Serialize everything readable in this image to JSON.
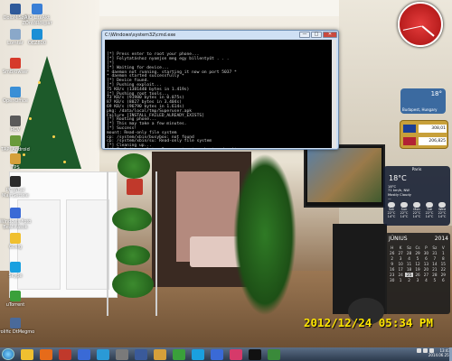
{
  "desktop_icons": [
    {
      "label": "DoloMiSzÓ",
      "icon": "app-icon",
      "color": "#2f5a9a"
    },
    {
      "label": "AIO LiteAkt ZÖntöRökpár",
      "icon": "app-icon",
      "color": "#3a7fd6"
    },
    {
      "label": "Lomtár",
      "icon": "recycle-bin-icon",
      "color": "#8aa8c9"
    },
    {
      "label": "OEZ800",
      "icon": "app-icon",
      "color": "#1c8fd6"
    },
    {
      "label": "SmBrowser",
      "icon": "app-icon",
      "color": "#d63a2a"
    },
    {
      "label": "OpenOffice",
      "icon": "app-icon",
      "color": "#3a8fd6"
    },
    {
      "label": "RCV",
      "icon": "app-icon",
      "color": "#5a5a5a"
    },
    {
      "label": "TAPI Android",
      "icon": "app-icon",
      "color": "#6a9a3a"
    },
    {
      "label": "TPS",
      "icon": "app-icon",
      "color": "#d6a03a"
    },
    {
      "label": "PCIWhal MainSettele",
      "icon": "app-icon",
      "color": "#2a2a2a"
    },
    {
      "label": "Windows Fotó Beállítások",
      "icon": "app-icon",
      "color": "#3a6ad6"
    },
    {
      "label": "Gosig",
      "icon": "app-icon",
      "color": "#f0c030"
    },
    {
      "label": "Skype",
      "icon": "skype-icon",
      "color": "#1aa0e0"
    },
    {
      "label": "uTorrent",
      "icon": "utorrent-icon",
      "color": "#3aa03a"
    },
    {
      "label": "Prolific DtMegmo",
      "icon": "app-icon",
      "color": "#4a6a9a"
    }
  ],
  "cmd_window": {
    "title": "C:\\Windows\\system32\\cmd.exe",
    "minimize": "—",
    "maximize": "□",
    "close": "✕",
    "lines": [
      "[*] Press enter to root your phone...",
      "[*] Folytatáshoz nyomjon meg egy billentyűt . . .",
      "[*]",
      "[*] Waiting for device...",
      "* daemon not running. starting it now on port 5037 *",
      "* daemon started successfully *",
      "[*] Device found.",
      "[*] Pushing exploit...",
      "75 KB/s (1381440 bytes in 1.419s)",
      "[*] Pushing root tools...",
      "73 KB/s (91980 bytes in 0.075s)",
      "87 KB/s (8027 bytes in 3.404s)",
      "69 KB/s (96790 bytes in 1.614s)",
      "pkg: /data/local/tmp/Superuser.apk",
      "Failure [INSTALL_FAILED_ALREADY_EXISTS]",
      "[*] Rooting phone...",
      "[*] This may take a few minutes.",
      "[*] Success!",
      "mount: Read-only file system",
      "cp: /system/xbin/busybox: not found",
      "cp: /system/xbin/su: Read-only file system",
      "[*] Cleaning up...",
      "[*] Exploit complete. Press enter to reboot and exit.",
      "[*] Folytatáshoz nyomjon meg egy billentyűt . . ."
    ]
  },
  "weather_small": {
    "temp": "18°",
    "place": "Budapest, Hungary"
  },
  "currency": {
    "rows": [
      {
        "code": "EUR",
        "value": "308,01",
        "flag_color": "#1c3f94"
      },
      {
        "code": "USD",
        "value": "206,825",
        "flag_color": "#b22234"
      }
    ]
  },
  "weather_big": {
    "city": "Paris",
    "temp": "18°C",
    "lines": [
      "18°C",
      "71 km/h, NW",
      "Mostly Cloudy",
      "—"
    ],
    "forecast": [
      {
        "day": "Sat",
        "hi": "22°C",
        "lo": "14°C"
      },
      {
        "day": "Sun",
        "hi": "22°C",
        "lo": "14°C"
      },
      {
        "day": "Mon",
        "hi": "22°C",
        "lo": "14°C"
      },
      {
        "day": "Tue",
        "hi": "22°C",
        "lo": "14°C"
      },
      {
        "day": "Wed",
        "hi": "22°C",
        "lo": "14°C"
      }
    ]
  },
  "calendar": {
    "month": "JÚNIUS",
    "year": "2014",
    "weekdays": [
      "H",
      "K",
      "Sz",
      "Cs",
      "P",
      "Sz",
      "V"
    ],
    "days": [
      "26",
      "27",
      "28",
      "29",
      "30",
      "31",
      "1",
      "2",
      "3",
      "4",
      "5",
      "6",
      "7",
      "8",
      "9",
      "10",
      "11",
      "12",
      "13",
      "14",
      "15",
      "16",
      "17",
      "18",
      "19",
      "20",
      "21",
      "22",
      "23",
      "24",
      "25",
      "26",
      "27",
      "28",
      "29",
      "30",
      "1",
      "2",
      "3",
      "4",
      "5",
      "6"
    ],
    "today": "25"
  },
  "camera_timestamp": "2012/12/24 05:34 PM",
  "taskbar": {
    "apps": [
      {
        "icon": "explorer-icon",
        "color": "#f0c030"
      },
      {
        "icon": "firefox-icon",
        "color": "#e66b1a"
      },
      {
        "icon": "app-icon",
        "color": "#c0392b"
      },
      {
        "icon": "mail-icon",
        "color": "#3a6ad6"
      },
      {
        "icon": "app-icon",
        "color": "#2a9ad6"
      },
      {
        "icon": "app-icon",
        "color": "#7a7a7a"
      },
      {
        "icon": "save-icon",
        "color": "#3a5a9a"
      },
      {
        "icon": "app-icon",
        "color": "#d6a03a"
      },
      {
        "icon": "utorrent-icon",
        "color": "#3aa03a"
      },
      {
        "icon": "skype-icon",
        "color": "#1aa0e0"
      },
      {
        "icon": "app-icon",
        "color": "#3a6ad6"
      },
      {
        "icon": "app-icon",
        "color": "#d63a6a"
      },
      {
        "icon": "cmd-icon",
        "color": "#111111"
      },
      {
        "icon": "app-icon",
        "color": "#3a8a3a"
      }
    ],
    "time": "13:43",
    "date": "2014.06.25."
  }
}
